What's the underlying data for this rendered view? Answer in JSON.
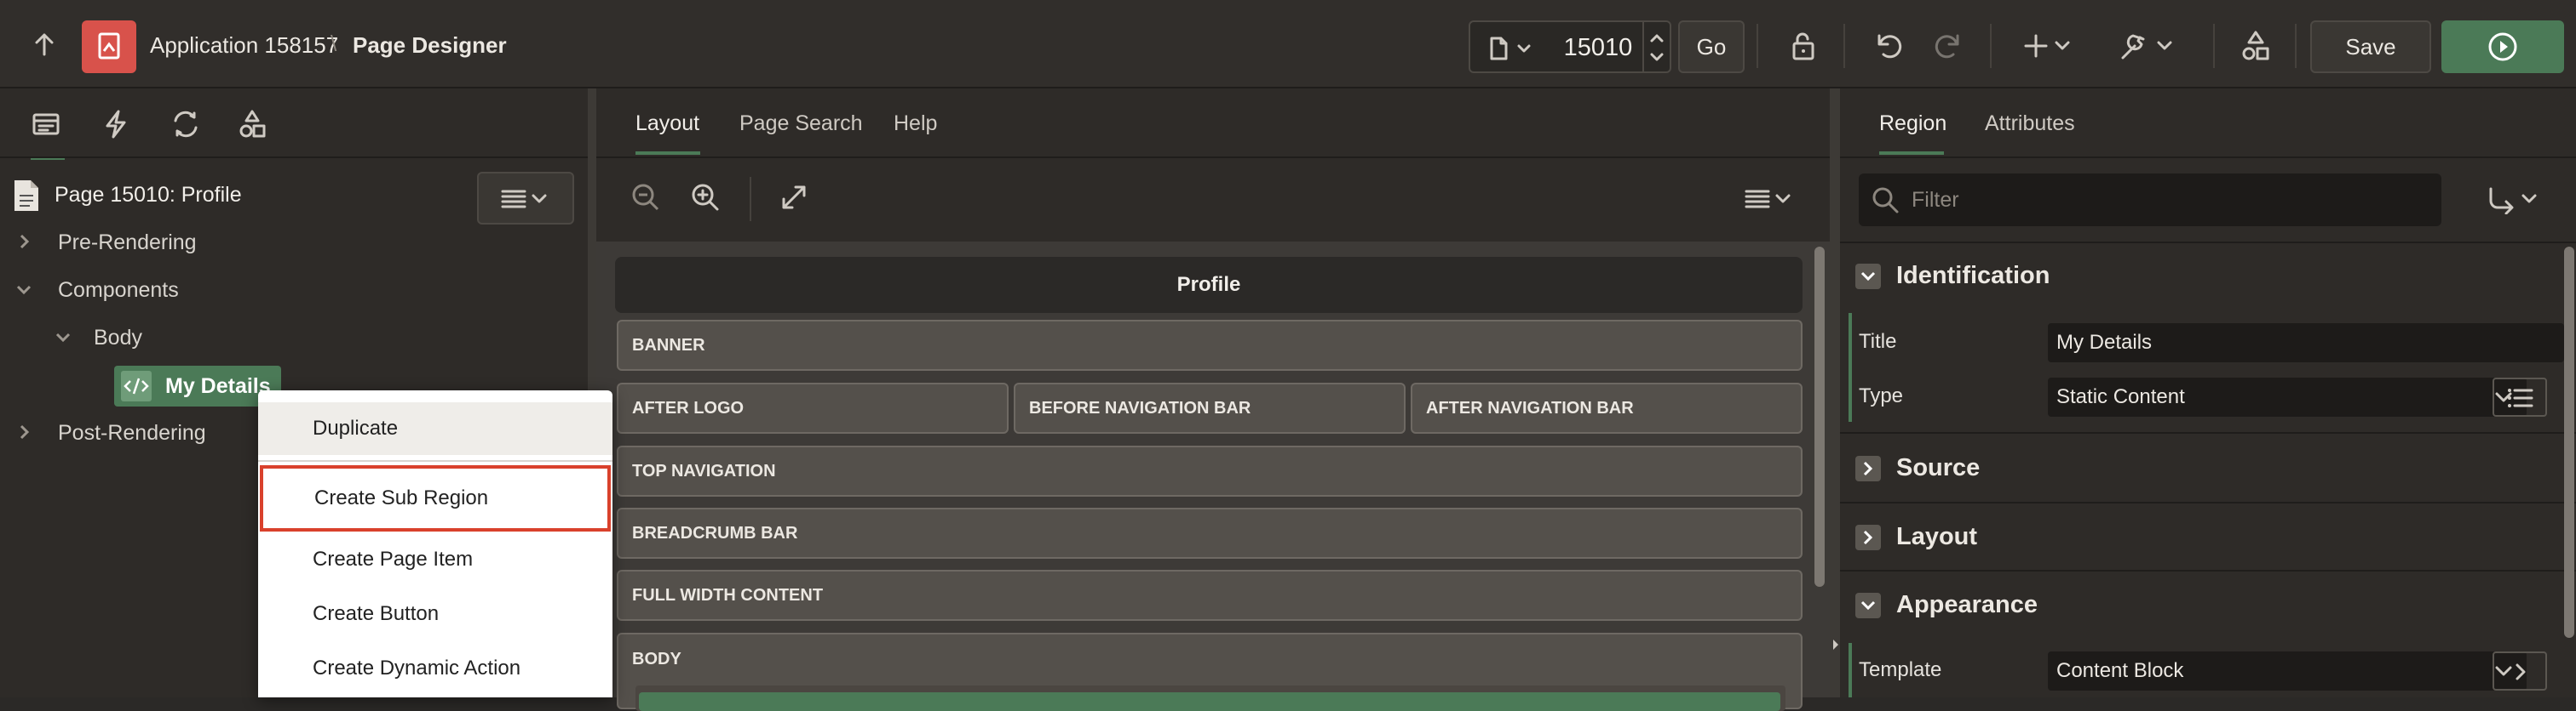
{
  "topbar": {
    "app_name": "Application 158157",
    "separator": "\\",
    "page_designer": "Page Designer",
    "page_number": "15010",
    "go_label": "Go",
    "save_label": "Save"
  },
  "left": {
    "page_title": "Page 15010: Profile",
    "tree": {
      "pre_rendering": "Pre-Rendering",
      "components": "Components",
      "body": "Body",
      "my_details": "My Details",
      "post_rendering": "Post-Rendering"
    }
  },
  "context_menu": {
    "items": [
      "Duplicate",
      "Create Sub Region",
      "Create Page Item",
      "Create Button",
      "Create Dynamic Action"
    ],
    "highlighted": "Create Sub Region"
  },
  "center": {
    "tabs": [
      "Layout",
      "Page Search",
      "Help"
    ],
    "active_tab": "Layout",
    "page_title": "Profile",
    "regions": {
      "banner": "BANNER",
      "after_logo": "AFTER LOGO",
      "before_navigation_bar": "BEFORE NAVIGATION BAR",
      "after_navigation_bar": "AFTER NAVIGATION BAR",
      "top_navigation": "TOP NAVIGATION",
      "breadcrumb_bar": "BREADCRUMB BAR",
      "full_width_content": "FULL WIDTH CONTENT",
      "body": "BODY"
    }
  },
  "right": {
    "tabs": [
      "Region",
      "Attributes"
    ],
    "active_tab": "Region",
    "filter_placeholder": "Filter",
    "sections": {
      "identification": "Identification",
      "source": "Source",
      "layout": "Layout",
      "appearance": "Appearance"
    },
    "fields": {
      "title_label": "Title",
      "title_value": "My Details",
      "type_label": "Type",
      "type_value": "Static Content",
      "template_label": "Template",
      "template_value": "Content Block"
    }
  },
  "colors": {
    "accent_green": "#4b7a57",
    "app_icon_red": "#d8524b",
    "highlight_border": "#d9412c"
  }
}
